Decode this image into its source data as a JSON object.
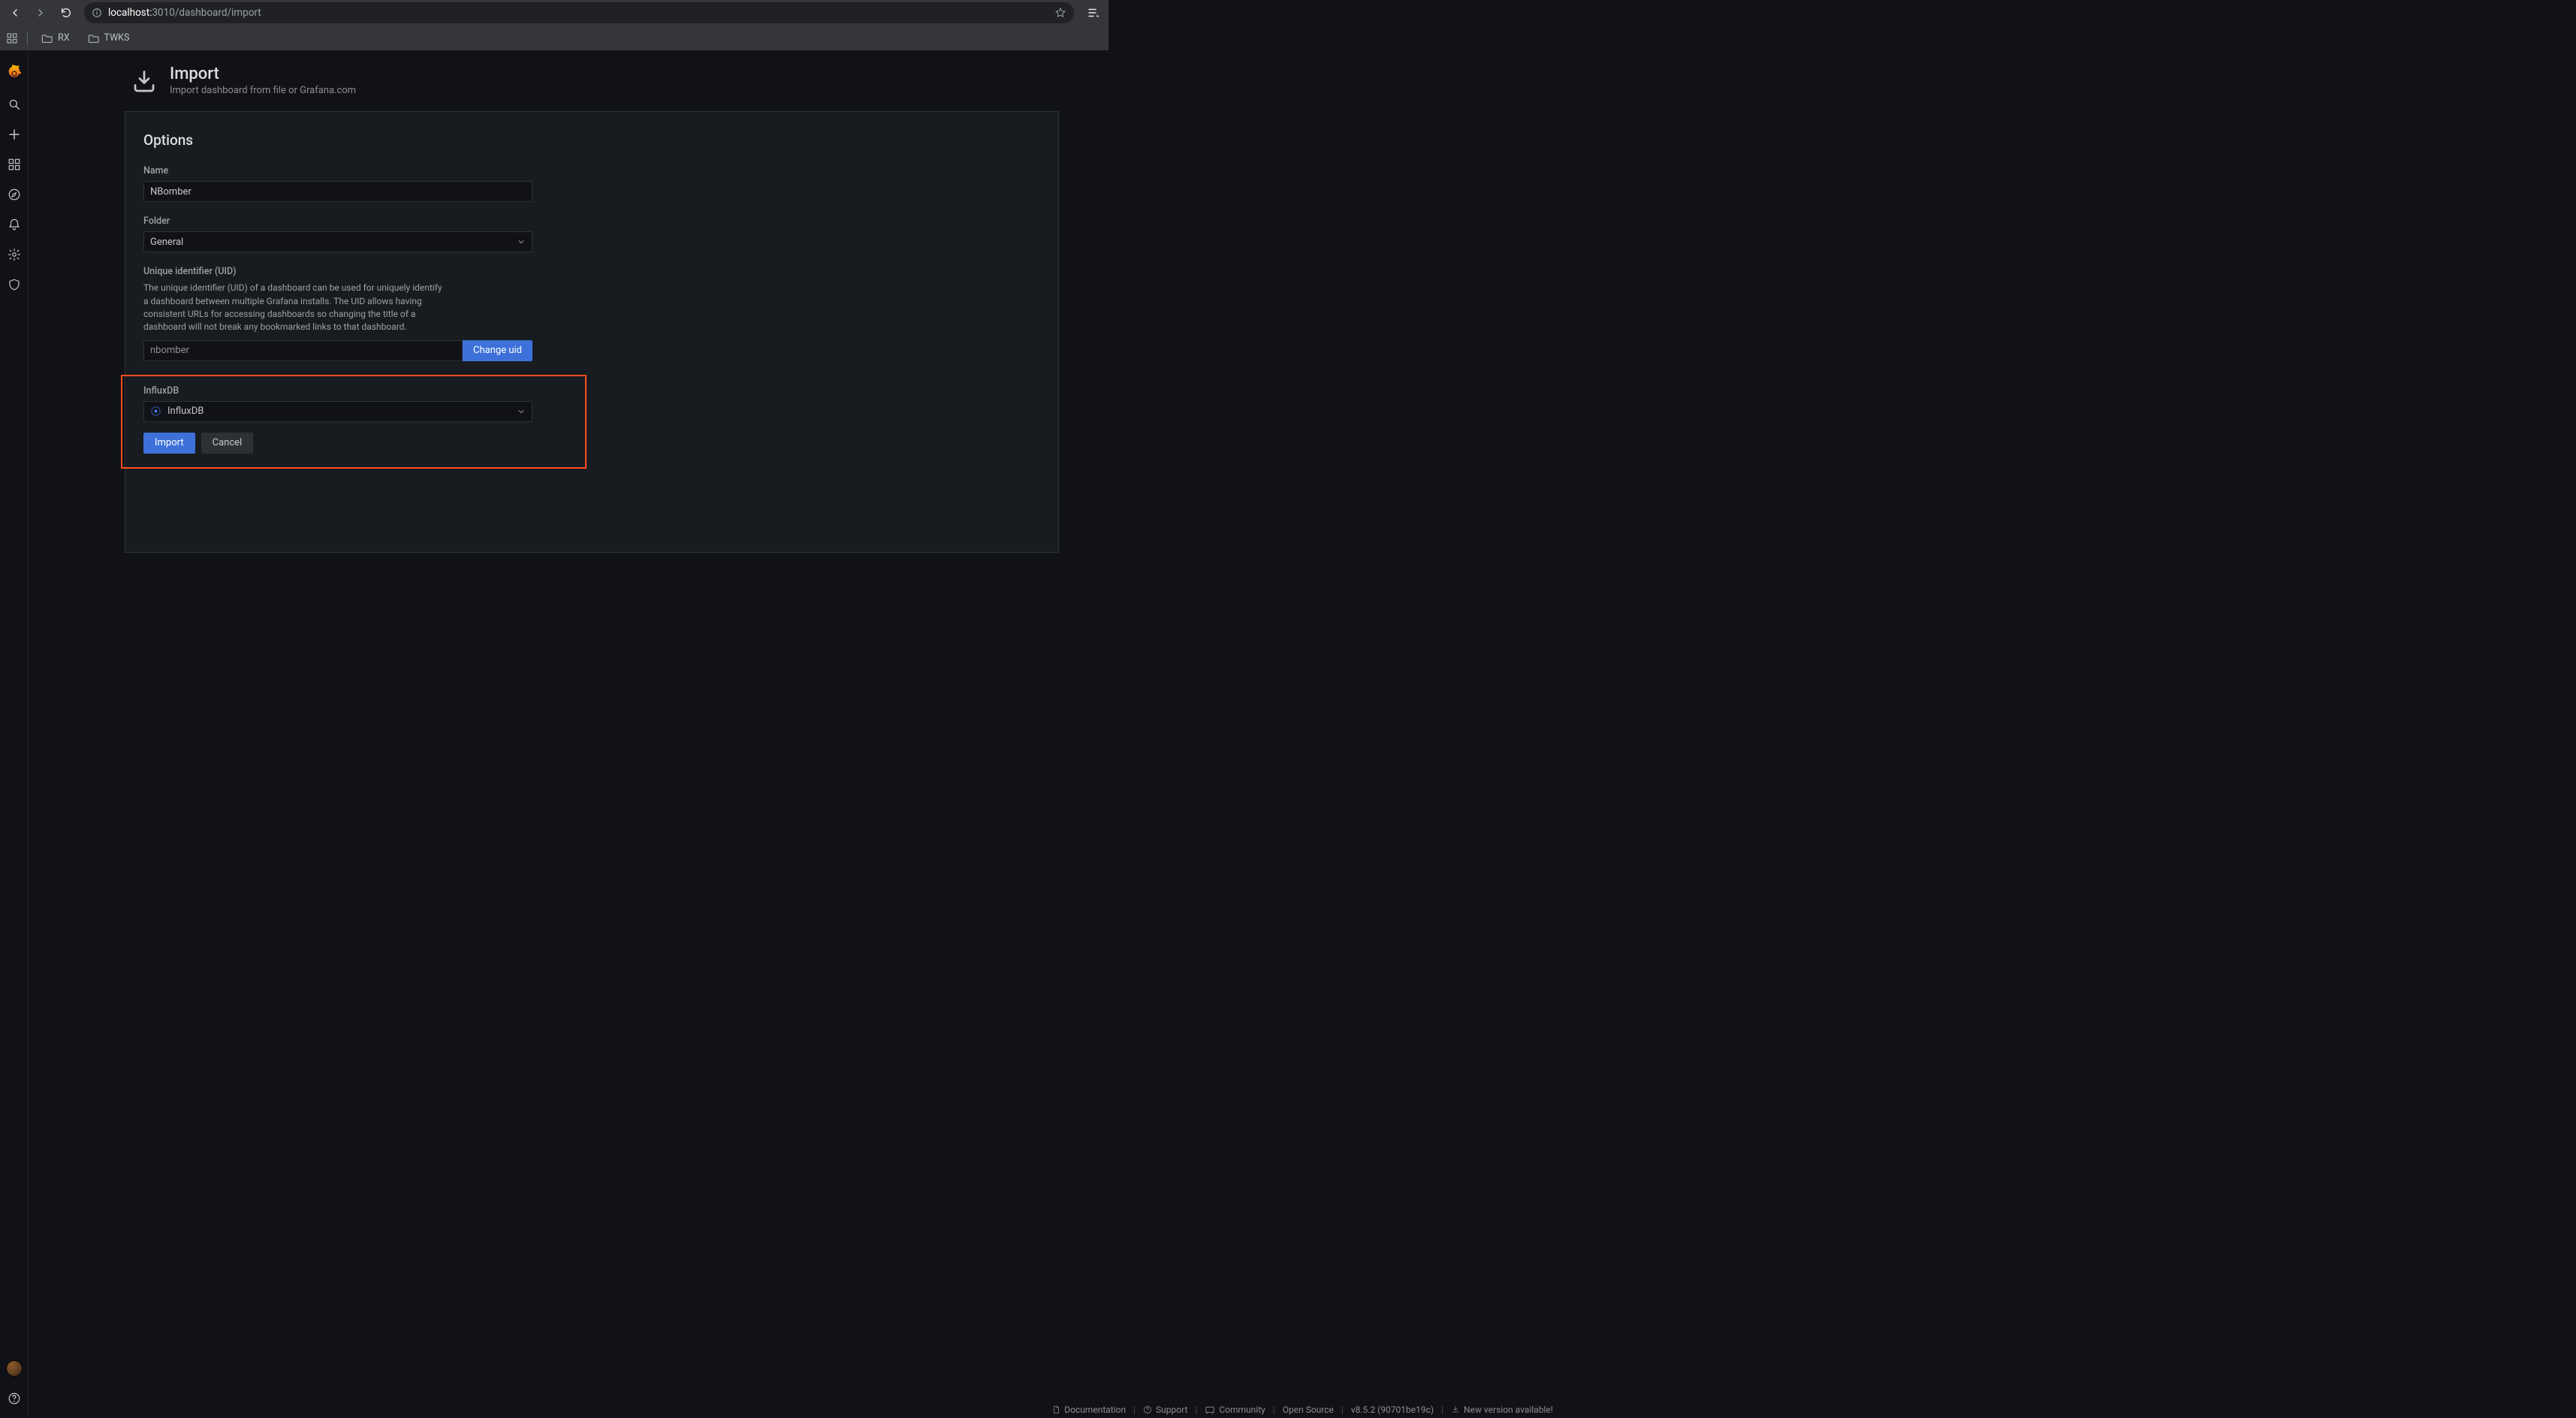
{
  "browser": {
    "url_host": "localhost:",
    "url_port_path": "3010/dashboard/import",
    "bookmarks": [
      "RX",
      "TWKS"
    ]
  },
  "page": {
    "title": "Import",
    "subtitle": "Import dashboard from file or Grafana.com"
  },
  "panel": {
    "heading": "Options",
    "name_label": "Name",
    "name_value": "NBomber",
    "folder_label": "Folder",
    "folder_value": "General",
    "uid_label": "Unique identifier (UID)",
    "uid_desc": "The unique identifier (UID) of a dashboard can be used for uniquely identify a dashboard between multiple Grafana installs. The UID allows having consistent URLs for accessing dashboards so changing the title of a dashboard will not break any bookmarked links to that dashboard.",
    "uid_value": "nbomber",
    "uid_button": "Change uid",
    "ds_label": "InfluxDB",
    "ds_value": "InfluxDB",
    "import_button": "Import",
    "cancel_button": "Cancel"
  },
  "footer": {
    "documentation": "Documentation",
    "support": "Support",
    "community": "Community",
    "open_source": "Open Source",
    "version": "v8.5.2 (90701be19c)",
    "new_version": "New version available!"
  }
}
